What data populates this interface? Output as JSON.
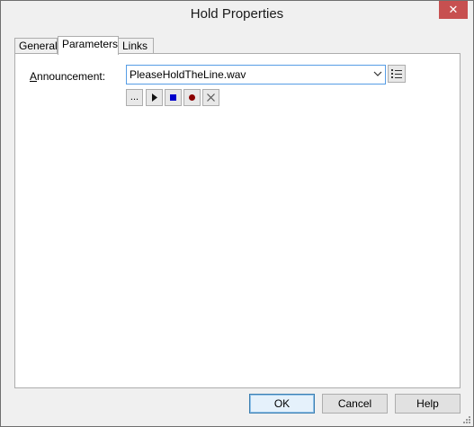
{
  "window": {
    "title": "Hold Properties",
    "close_glyph": "✕"
  },
  "tabs": [
    {
      "label": "General"
    },
    {
      "label": "Parameters",
      "active": true
    },
    {
      "label": "Links"
    }
  ],
  "parameters": {
    "announcement_label_accel": "A",
    "announcement_label_rest": "nnouncement:",
    "announcement_value": "PleaseHoldTheLine.wav"
  },
  "media_buttons": {
    "browse": "...",
    "play_icon": "play-icon",
    "stop_icon": "stop-icon",
    "record_icon": "record-icon",
    "delete_icon": "delete-icon"
  },
  "footer": {
    "ok": "OK",
    "cancel": "Cancel",
    "help": "Help"
  },
  "colors": {
    "accent": "#569de5",
    "stop": "#0000cc",
    "record": "#8b0000",
    "close": "#c75050"
  }
}
